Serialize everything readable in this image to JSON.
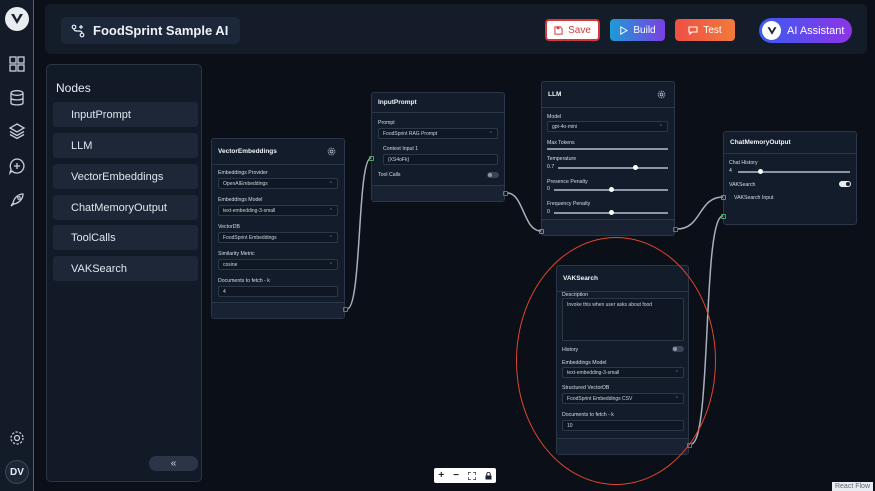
{
  "workspace": {
    "title": "FoodSprint Sample AI"
  },
  "toolbar": {
    "save_label": "Save",
    "build_label": "Build",
    "test_label": "Test",
    "ai_label": "AI Assistant"
  },
  "rail": {
    "avatar_initials": "DV"
  },
  "sidebar": {
    "title": "Nodes",
    "items": [
      {
        "label": "InputPrompt"
      },
      {
        "label": "LLM"
      },
      {
        "label": "VectorEmbeddings"
      },
      {
        "label": "ChatMemoryOutput"
      },
      {
        "label": "ToolCalls"
      },
      {
        "label": "VAKSearch"
      }
    ],
    "collapse_label": "«"
  },
  "nodes": {
    "vector": {
      "title": "VectorEmbeddings",
      "provider_label": "Embeddings Provider",
      "provider_value": "OpenAIEmbeddings",
      "model_label": "Embeddings Model",
      "model_value": "text-embedding-3-small",
      "vectordb_label": "VectorDB",
      "vectordb_value": "FoodSprint Embeddings",
      "similarity_label": "Similarity Metric",
      "similarity_value": "cosine",
      "k_label": "Documents to fetch - k",
      "k_value": "4"
    },
    "input": {
      "title": "InputPrompt",
      "prompt_label": "Prompt",
      "prompt_value": "FoodSprint RAG Prompt",
      "context_label": "Context Input 1",
      "context_value": "{XS4oFk}",
      "tools_label": "Tool Calls"
    },
    "llm": {
      "title": "LLM",
      "model_label": "Model",
      "model_value": "gpt-4o-mini",
      "max_tokens_label": "Max Tokens",
      "temperature_label": "Temperature",
      "temperature_value": "0.7",
      "temperature_fraction": 0.7,
      "presence_label": "Presence Penalty",
      "presence_value": "0",
      "presence_fraction": 0.5,
      "frequency_label": "Frequency Penalty",
      "frequency_value": "0",
      "frequency_fraction": 0.5
    },
    "memory": {
      "title": "ChatMemoryOutput",
      "history_label": "Chat History",
      "history_value": "4",
      "history_fraction": 0.2,
      "vak_label": "VAKSearch",
      "vak_input_label": "VAKSearch Input"
    },
    "vak": {
      "title": "VAKSearch",
      "desc_label": "Description",
      "desc_value": "Invoke this when user asks about food",
      "history_label": "History",
      "model_label": "Embeddings Model",
      "model_value": "text-embedding-3-small",
      "db_label": "Structured VectorDB",
      "db_value": "FoodSprint Embeddings CSV",
      "k_label": "Documents to fetch - k",
      "k_value": "10"
    }
  },
  "canvas": {
    "attribution": "React Flow"
  },
  "colors": {
    "accent": "#d5383b",
    "port_in": "#3fae5d",
    "port_out": "#d64545",
    "annotation": "#e2452f"
  }
}
